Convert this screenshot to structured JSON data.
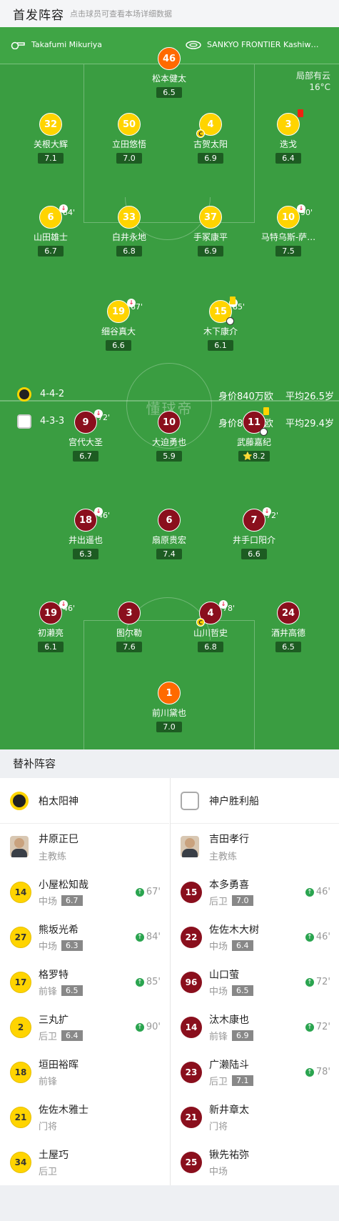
{
  "header": {
    "title": "首发阵容",
    "subtitle": "点击球员可查看本场详细数据"
  },
  "info": {
    "referee": "Takafumi Mikuriya",
    "stadium": "SANKYO FRONTIER Kashiw…",
    "weather": "局部有云",
    "temperature": "16°C"
  },
  "watermark": "懂球帝",
  "team_stats": [
    {
      "formation": "4-4-2",
      "value": "身价840万欧",
      "age": "平均26.5岁",
      "team": "home"
    },
    {
      "formation": "4-3-3",
      "value": "身价890万欧",
      "age": "平均29.4岁",
      "team": "away"
    }
  ],
  "home_players": [
    {
      "num": "46",
      "name": "松本健太",
      "rating": "6.5",
      "style": "orange",
      "x": 0,
      "y": 0
    },
    {
      "num": "32",
      "name": "关根大辉",
      "rating": "7.1",
      "style": "yellow"
    },
    {
      "num": "50",
      "name": "立田悠悟",
      "rating": "7.0",
      "style": "yellow"
    },
    {
      "num": "4",
      "name": "古贺太阳",
      "rating": "6.9",
      "style": "yellow",
      "captain": "C"
    },
    {
      "num": "3",
      "name": "迭戈",
      "rating": "6.4",
      "style": "yellow",
      "card": "red"
    },
    {
      "num": "6",
      "name": "山田雄士",
      "rating": "6.7",
      "style": "yellow",
      "subout": "84'"
    },
    {
      "num": "33",
      "name": "白井永地",
      "rating": "6.8",
      "style": "yellow"
    },
    {
      "num": "37",
      "name": "手冢康平",
      "rating": "6.9",
      "style": "yellow"
    },
    {
      "num": "10",
      "name": "马特乌斯-萨…",
      "rating": "7.5",
      "style": "yellow",
      "subout": "90'"
    },
    {
      "num": "19",
      "name": "细谷真大",
      "rating": "6.6",
      "style": "yellow",
      "subout": "67'"
    },
    {
      "num": "15",
      "name": "木下康介",
      "rating": "6.1",
      "style": "yellow",
      "subout": "85'",
      "card": "yellow",
      "goal": true
    }
  ],
  "away_players": [
    {
      "num": "9",
      "name": "宫代大圣",
      "rating": "6.7",
      "style": "red",
      "subout": "72'"
    },
    {
      "num": "10",
      "name": "大迫勇也",
      "rating": "5.9",
      "style": "red"
    },
    {
      "num": "11",
      "name": "武藤嘉纪",
      "rating": "8.2",
      "style": "red",
      "card": "yellow",
      "goal": true,
      "star": "⭐"
    },
    {
      "num": "18",
      "name": "井出遥也",
      "rating": "6.3",
      "style": "red",
      "subout": "46'"
    },
    {
      "num": "6",
      "name": "扇原贵宏",
      "rating": "7.4",
      "style": "red"
    },
    {
      "num": "7",
      "name": "井手口阳介",
      "rating": "6.6",
      "style": "red",
      "subout": "72'"
    },
    {
      "num": "19",
      "name": "初濑亮",
      "rating": "6.1",
      "style": "red",
      "subout": "46'"
    },
    {
      "num": "3",
      "name": "图尔勒",
      "rating": "7.6",
      "style": "red"
    },
    {
      "num": "4",
      "name": "山川哲史",
      "rating": "6.8",
      "style": "red",
      "subout": "78'",
      "captain": "C"
    },
    {
      "num": "24",
      "name": "酒井高德",
      "rating": "6.5",
      "style": "red"
    },
    {
      "num": "1",
      "name": "前川黛也",
      "rating": "7.0",
      "style": "orange"
    }
  ],
  "bench_title": "替补阵容",
  "bench": {
    "home": {
      "team": "柏太阳神",
      "coach": {
        "name": "井原正巳",
        "role": "主教练"
      },
      "players": [
        {
          "num": "14",
          "name": "小屋松知哉",
          "pos": "中场",
          "rating": "6.7",
          "in": "67'"
        },
        {
          "num": "27",
          "name": "熊坂光希",
          "pos": "中场",
          "rating": "6.3",
          "in": "84'"
        },
        {
          "num": "17",
          "name": "格罗特",
          "pos": "前锋",
          "rating": "6.5",
          "in": "85'"
        },
        {
          "num": "2",
          "name": "三丸扩",
          "pos": "后卫",
          "rating": "6.4",
          "in": "90'"
        },
        {
          "num": "18",
          "name": "垣田裕晖",
          "pos": "前锋",
          "rating": "",
          "in": ""
        },
        {
          "num": "21",
          "name": "佐佐木雅士",
          "pos": "门将",
          "rating": "",
          "in": ""
        },
        {
          "num": "34",
          "name": "土屋巧",
          "pos": "后卫",
          "rating": "",
          "in": ""
        }
      ]
    },
    "away": {
      "team": "神户胜利船",
      "coach": {
        "name": "吉田孝行",
        "role": "主教练"
      },
      "players": [
        {
          "num": "15",
          "name": "本多勇喜",
          "pos": "后卫",
          "rating": "7.0",
          "in": "46'"
        },
        {
          "num": "22",
          "name": "佐佐木大树",
          "pos": "中场",
          "rating": "6.4",
          "in": "46'"
        },
        {
          "num": "96",
          "name": "山口萤",
          "pos": "中场",
          "rating": "6.5",
          "in": "72'"
        },
        {
          "num": "14",
          "name": "汰木康也",
          "pos": "前锋",
          "rating": "6.9",
          "in": "72'"
        },
        {
          "num": "23",
          "name": "广濑陆斗",
          "pos": "后卫",
          "rating": "7.1",
          "in": "78'"
        },
        {
          "num": "21",
          "name": "新井章太",
          "pos": "门将",
          "rating": "",
          "in": ""
        },
        {
          "num": "25",
          "name": "锹先祐弥",
          "pos": "中场",
          "rating": "",
          "in": ""
        }
      ]
    }
  },
  "colors": {
    "pitch": "#3a9d41",
    "home": "#ffd400",
    "away": "#8a0f1d",
    "keeper": "#ff6a00"
  }
}
